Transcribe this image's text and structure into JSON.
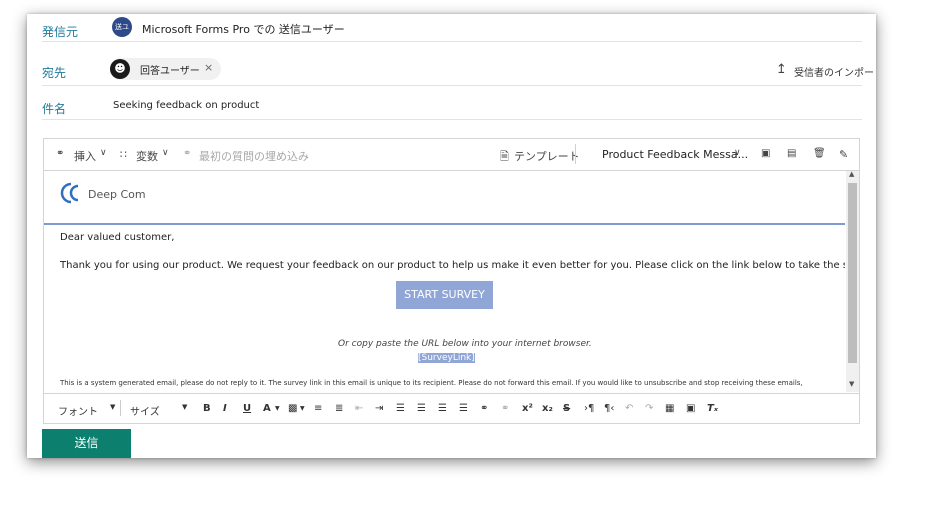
{
  "from": {
    "label": "発信元",
    "avatar_text": "送ユ",
    "value": "Microsoft Forms Pro での 送信ユーザー",
    "avatar_color": "#2e4a8a"
  },
  "to": {
    "label": "宛先",
    "recipient": "回答ユーザー",
    "remove": "×",
    "import_label": "受信者のインポート",
    "avatar_color": "#1a1a1a"
  },
  "subject": {
    "label": "件名",
    "value": "Seeking feedback on product"
  },
  "toolbar": {
    "insert": "挿入",
    "variable": "変数",
    "embed": "最初の質問の埋め込み",
    "template": "テンプレート",
    "template_select": "Product Feedback Messa..."
  },
  "email": {
    "logo_text": "Deep Com",
    "greeting": "Dear valued customer,",
    "body": "Thank you for using our product. We request your feedback on our product to help us make it even better for you. Please click on the link below to take the survey.",
    "start_button": "START SURVEY",
    "copy_hint": "Or copy paste the URL below into your internet browser.",
    "link": "[SurveyLink]",
    "footer": "This is a system generated email, please do not reply to it. The survey link in this email is unique to its recipient. Please do not forward this email. If you would like to unsubscribe and stop receiving these emails,"
  },
  "format": {
    "font": "フォント",
    "size": "サイズ"
  },
  "send_label": "送信",
  "colors": {
    "accent_label": "#1e7a9a",
    "send_button": "#0d7f6f",
    "start_button": "#8fa6d6"
  }
}
